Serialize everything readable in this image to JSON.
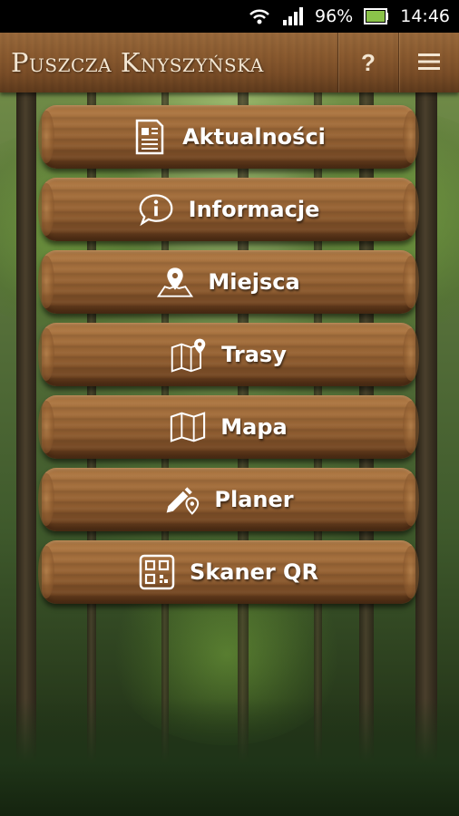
{
  "status_bar": {
    "battery": "96%",
    "time": "14:46",
    "icons": [
      "wifi-icon",
      "signal-icon",
      "battery-icon"
    ]
  },
  "app_bar": {
    "title": "Puszcza Knyszyńska",
    "help_label": "?",
    "menu_icon": "hamburger-menu-icon"
  },
  "menu": {
    "items": [
      {
        "label": "Aktualności",
        "icon": "newspaper-icon"
      },
      {
        "label": "Informacje",
        "icon": "info-bubble-icon"
      },
      {
        "label": "Miejsca",
        "icon": "map-pin-icon"
      },
      {
        "label": "Trasy",
        "icon": "route-map-icon"
      },
      {
        "label": "Mapa",
        "icon": "folded-map-icon"
      },
      {
        "label": "Planer",
        "icon": "pencil-pin-icon"
      },
      {
        "label": "Skaner QR",
        "icon": "qr-code-icon"
      }
    ]
  },
  "colors": {
    "wood_light": "#b07a45",
    "wood_dark": "#4f2e15",
    "label_text": "#ffffff",
    "status_bar_bg": "#000000"
  }
}
